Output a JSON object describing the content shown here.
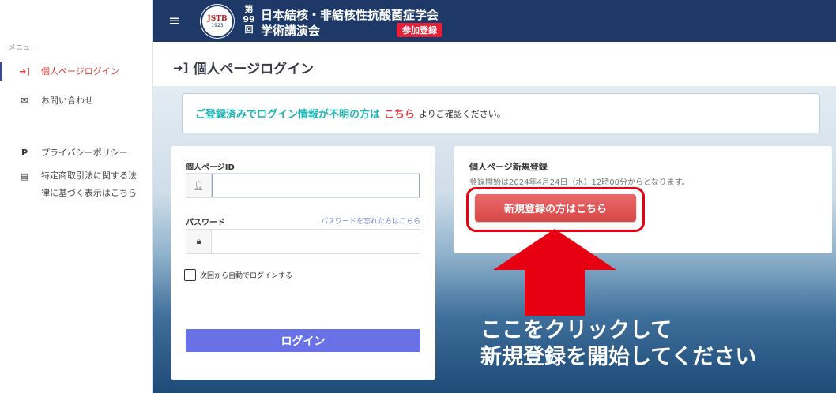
{
  "sidebar": {
    "caption": "メニュー",
    "items": [
      {
        "label": "個人ページログイン",
        "icon": "sign-in-icon"
      },
      {
        "label": "お問い合わせ",
        "icon": "envelope-icon"
      },
      {
        "label": "プライバシーポリシー",
        "icon": "parking-icon"
      },
      {
        "label": "特定商取引法に関する法律に基づく表示はこちら",
        "label_line1": "特定商取引法に関する法",
        "label_line2": "律に基づく表示はこちら",
        "icon": "file-icon"
      }
    ]
  },
  "header": {
    "logo_text": "JSTB",
    "logo_year": "1923",
    "kai_1": "第",
    "kai_2": "99",
    "kai_3": "回",
    "title_line1": "日本結核・非結核性抗酸菌症学会",
    "title_line2": "学術講演会",
    "badge": "参加登録"
  },
  "page": {
    "title": "個人ページログイン"
  },
  "notice": {
    "part1": "ご登録済みでログイン情報が不明の方は",
    "link": "こちら",
    "part2": "よりご確認ください。"
  },
  "login": {
    "id_label": "個人ページID",
    "id_value": "",
    "password_label": "パスワード",
    "password_value": "",
    "forgot_link": "パスワードを忘れた方はこちら",
    "remember_label": "次回から自動でログインする",
    "button": "ログイン"
  },
  "newreg": {
    "heading": "個人ページ新規登録",
    "description": "登録開始は2024年4月24日（水）12時00分からとなります。",
    "button": "新規登録の方はこちら"
  },
  "callout": {
    "line1": "ここをクリックして",
    "line2": "新規登録を開始してください"
  },
  "colors": {
    "header_bg": "#1e3967",
    "accent_red": "#e23c3c",
    "teal": "#1eb5b5",
    "login_button": "#6872e6",
    "arrow": "#e60012"
  }
}
